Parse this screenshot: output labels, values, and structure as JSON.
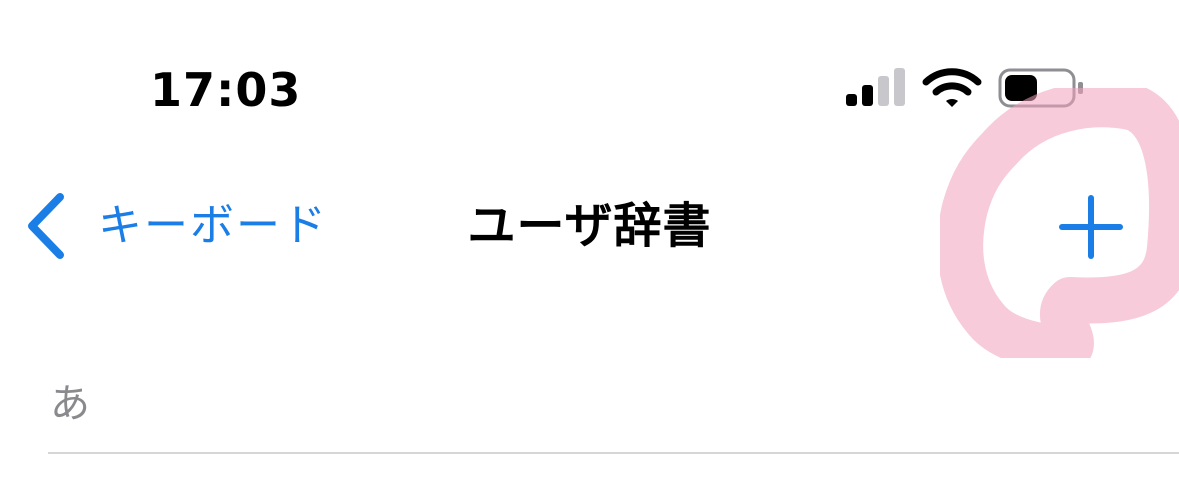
{
  "status_bar": {
    "time": "17:03",
    "signal_icon": "cellular-signal-icon",
    "wifi_icon": "wifi-icon",
    "battery_icon": "battery-icon",
    "signal_bars_active": 2,
    "signal_bars_total": 4,
    "battery_level": 0.45
  },
  "nav_bar": {
    "back_label": "キーボード",
    "title": "ユーザ辞書",
    "back_icon": "chevron-left-icon",
    "add_icon": "plus-icon"
  },
  "list": {
    "section_header": "あ"
  },
  "colors": {
    "accent": "#1a7ee6",
    "highlight": "#f2a0bb",
    "secondary_text": "#8a8a8e"
  }
}
